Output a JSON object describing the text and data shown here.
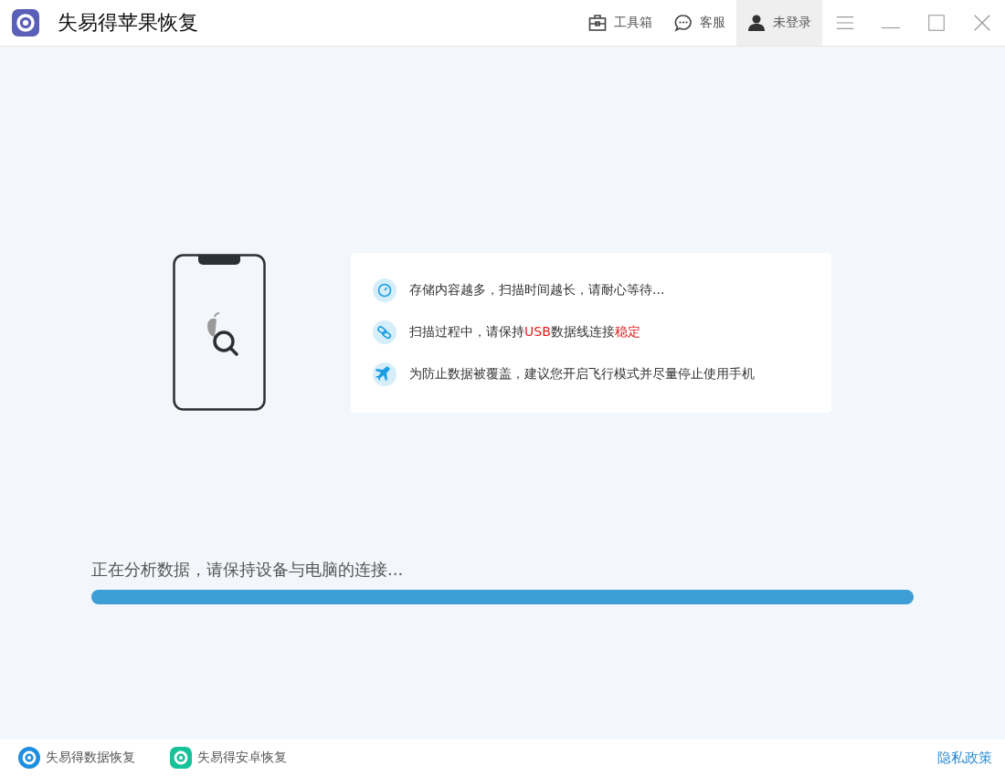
{
  "window": {
    "title": "失易得苹果恢复"
  },
  "toolbar": [
    {
      "kind": "toolbox",
      "label": "工具箱",
      "selected": false
    },
    {
      "kind": "service",
      "label": "客服",
      "selected": false
    },
    {
      "kind": "user",
      "label": "未登录",
      "selected": true
    }
  ],
  "tips": [
    {
      "kind": "clock",
      "segments": [
        {
          "text": "存储内容越多，扫描时间越长，请耐心等待...",
          "highlight": false
        }
      ]
    },
    {
      "kind": "link",
      "segments": [
        {
          "text": "扫描过程中，请保持",
          "highlight": false
        },
        {
          "text": "USB",
          "highlight": true
        },
        {
          "text": "数据线连接",
          "highlight": false
        },
        {
          "text": "稳定",
          "highlight": true
        }
      ]
    },
    {
      "kind": "plane",
      "segments": [
        {
          "text": "为防止数据被覆盖，建议您开启飞行模式并尽量停止使用手机",
          "highlight": false
        }
      ]
    }
  ],
  "progress": {
    "label": "正在分析数据，请保持设备与电脑的连接...",
    "level": 1
  },
  "footer": {
    "apps": [
      {
        "kind": "data",
        "label": "失易得数据恢复"
      },
      {
        "kind": "android",
        "label": "失易得安卓恢复"
      }
    ],
    "privacy": "隐私政策"
  }
}
